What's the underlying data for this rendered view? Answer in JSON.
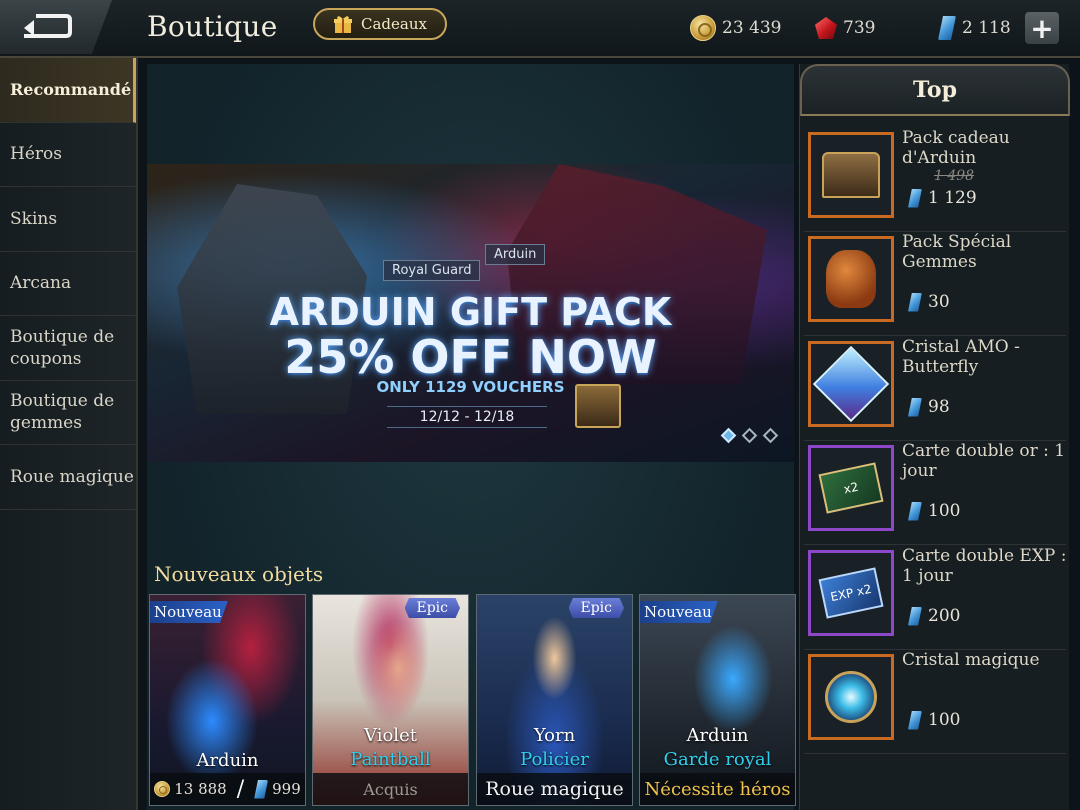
{
  "header": {
    "title": "Boutique",
    "gift_label": "Cadeaux",
    "currencies": [
      {
        "type": "gold",
        "icon": "gold-coin-icon",
        "value": "23 439"
      },
      {
        "type": "ruby",
        "icon": "ruby-gem-icon",
        "value": "739"
      },
      {
        "type": "voucher",
        "icon": "voucher-icon",
        "value": "2 118"
      }
    ],
    "plus_label": "+"
  },
  "sidebar": {
    "items": [
      {
        "label": "Recommandé",
        "active": true
      },
      {
        "label": "Héros"
      },
      {
        "label": "Skins"
      },
      {
        "label": "Arcana"
      },
      {
        "label": "Boutique de coupons"
      },
      {
        "label": "Boutique de gemmes"
      },
      {
        "label": "Roue magique"
      }
    ]
  },
  "banner": {
    "tag_left": "Royal Guard",
    "tag_right": "Arduin",
    "title_line1": "ARDUIN GIFT PACK",
    "title_line2": "25% OFF NOW",
    "subtitle": "ONLY 1129 VOUCHERS",
    "dates": "12/12 - 12/18",
    "pages": 3,
    "active_page": 0
  },
  "new_items": {
    "title": "Nouveaux objets",
    "cards": [
      {
        "badge": "Nouveau",
        "name": "Arduin",
        "skin": "",
        "gold_price": "13 888",
        "voucher_price": "999",
        "foot": ""
      },
      {
        "badge": "Epic",
        "name": "Violet",
        "skin": "Paintball",
        "foot": "Acquis"
      },
      {
        "badge": "Epic",
        "name": "Yorn",
        "skin": "Policier",
        "foot": "Roue magique"
      },
      {
        "badge": "Nouveau",
        "name": "Arduin",
        "skin": "Garde royal",
        "foot": "Nécessite héros"
      }
    ]
  },
  "top": {
    "title": "Top",
    "items": [
      {
        "name": "Pack cadeau d'Arduin",
        "old_price": "1 498",
        "price": "1 129"
      },
      {
        "name": "Pack Spécial Gemmes",
        "price": "30"
      },
      {
        "name": "Cristal AMO - Butterfly",
        "price": "98"
      },
      {
        "name": "Carte double or : 1 jour",
        "price": "100",
        "art_label": "x2"
      },
      {
        "name": "Carte double EXP : 1 jour",
        "price": "200",
        "art_label": "EXP x2"
      },
      {
        "name": "Cristal magique",
        "price": "100"
      }
    ]
  },
  "colors": {
    "accent_gold": "#c8a659",
    "skin_cyan": "#2fd0ee",
    "requires_hero": "#f0c24a",
    "epic_badge": "#4e60c0",
    "new_badge": "#2b62c8"
  }
}
